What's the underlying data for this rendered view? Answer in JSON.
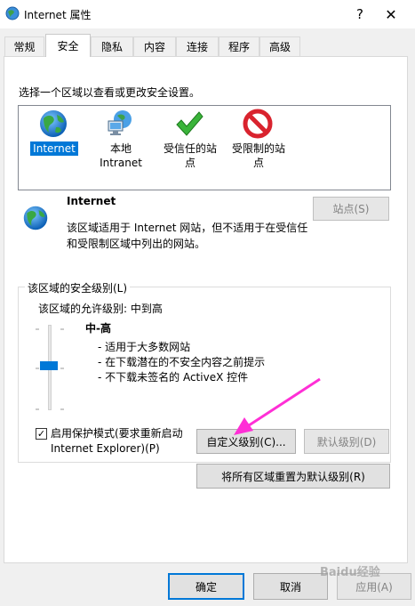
{
  "window": {
    "title": "Internet 属性",
    "help": "?",
    "close": "✕"
  },
  "tabs": [
    {
      "label": "常规"
    },
    {
      "label": "安全"
    },
    {
      "label": "隐私"
    },
    {
      "label": "内容"
    },
    {
      "label": "连接"
    },
    {
      "label": "程序"
    },
    {
      "label": "高级"
    }
  ],
  "security": {
    "prompt": "选择一个区域以查看或更改安全设置。",
    "zones": [
      {
        "line1": "Internet",
        "line2": ""
      },
      {
        "line1": "本地",
        "line2": "Intranet"
      },
      {
        "line1": "受信任的站",
        "line2": "点"
      },
      {
        "line1": "受限制的站",
        "line2": "点"
      }
    ],
    "selected_zone": {
      "title": "Internet",
      "description": "该区域适用于 Internet 网站，但不适用于在受信任和受限制区域中列出的网站。"
    },
    "sites_button": "站点(S)",
    "group_label": "该区域的安全级别(L)",
    "allowed_levels": "该区域的允许级别: 中到高",
    "level": {
      "name": "中-高",
      "lines": [
        "- 适用于大多数网站",
        "- 在下载潜在的不安全内容之前提示",
        "- 不下载未签名的 ActiveX 控件"
      ]
    },
    "protected_mode": {
      "checked": true,
      "check_glyph": "✓",
      "line1": "启用保护模式(要求重新启动",
      "line2": "Internet Explorer)(P)"
    },
    "custom_level_button": "自定义级别(C)...",
    "default_level_button": "默认级别(D)",
    "reset_all_button": "将所有区域重置为默认级别(R)"
  },
  "footer": {
    "ok": "确定",
    "cancel": "取消",
    "apply": "应用(A)"
  },
  "watermark": "Baidu经验",
  "colors": {
    "accent": "#0078d7",
    "arrow": "#ff2fd6"
  }
}
